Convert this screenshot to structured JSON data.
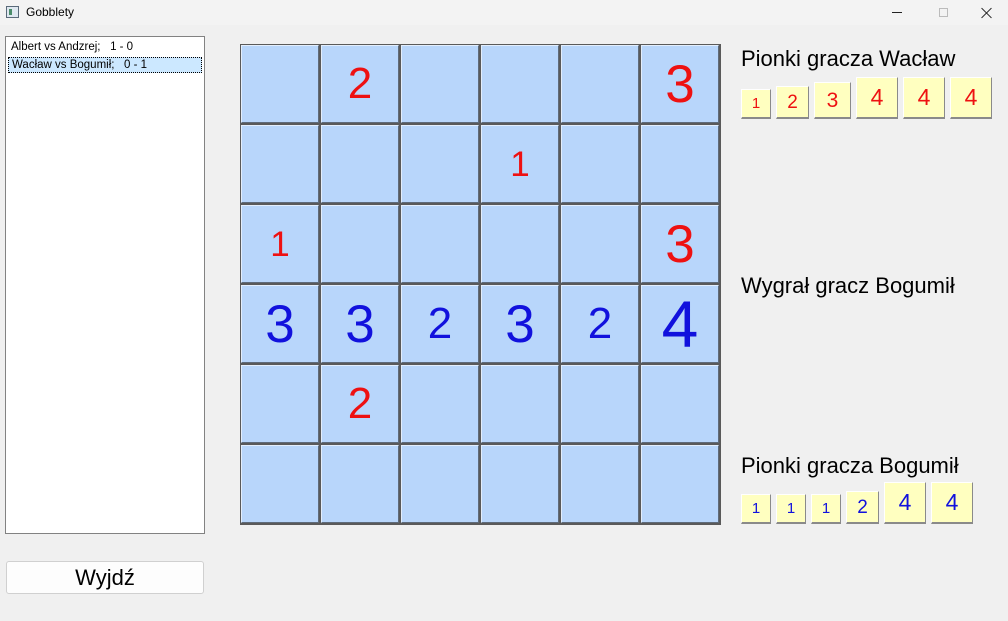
{
  "window": {
    "title": "Gobblety"
  },
  "colors": {
    "player_red": "#ee1111",
    "player_blue": "#1111dd",
    "cell_bg": "#b8d6fb",
    "piece_bg": "#ffffc0"
  },
  "games": [
    {
      "label": "Albert vs Andzrej;   1 - 0",
      "selected": false
    },
    {
      "label": "Wacław vs Bogumił;   0 - 1",
      "selected": true
    }
  ],
  "exit_label": "Wyjdź",
  "board": {
    "rows": 6,
    "cols": 6,
    "pieces": [
      {
        "row": 0,
        "col": 1,
        "size": 2,
        "color": "red"
      },
      {
        "row": 0,
        "col": 5,
        "size": 3,
        "color": "red"
      },
      {
        "row": 1,
        "col": 3,
        "size": 1,
        "color": "red"
      },
      {
        "row": 2,
        "col": 0,
        "size": 1,
        "color": "red"
      },
      {
        "row": 2,
        "col": 5,
        "size": 3,
        "color": "red"
      },
      {
        "row": 3,
        "col": 0,
        "size": 3,
        "color": "blue"
      },
      {
        "row": 3,
        "col": 1,
        "size": 3,
        "color": "blue"
      },
      {
        "row": 3,
        "col": 2,
        "size": 2,
        "color": "blue"
      },
      {
        "row": 3,
        "col": 3,
        "size": 3,
        "color": "blue"
      },
      {
        "row": 3,
        "col": 4,
        "size": 2,
        "color": "blue"
      },
      {
        "row": 3,
        "col": 5,
        "size": 4,
        "color": "blue"
      },
      {
        "row": 4,
        "col": 1,
        "size": 2,
        "color": "red"
      }
    ]
  },
  "player_top": {
    "label": "Pionki gracza Wacław",
    "color": "red",
    "pieces": [
      1,
      2,
      3,
      4,
      4,
      4
    ]
  },
  "status": "Wygrał gracz Bogumił",
  "player_bottom": {
    "label": "Pionki gracza Bogumił",
    "color": "blue",
    "pieces": [
      1,
      1,
      1,
      2,
      4,
      4
    ]
  }
}
